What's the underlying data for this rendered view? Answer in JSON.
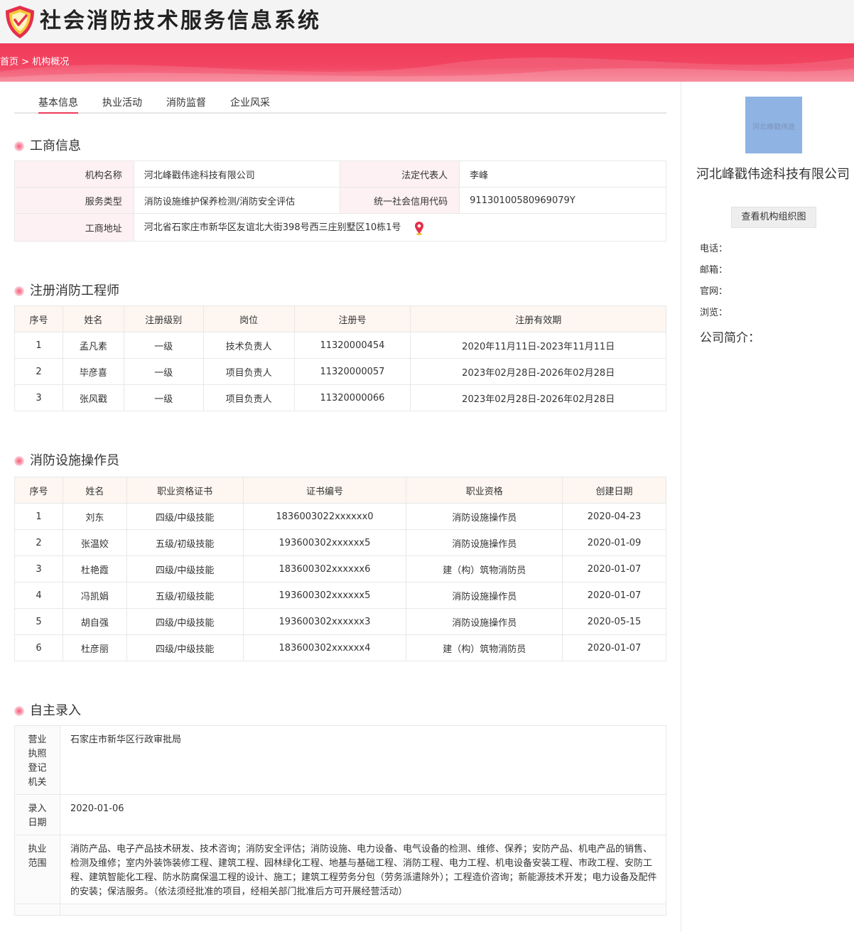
{
  "header": {
    "title": "社会消防技术服务信息系统"
  },
  "breadcrumb": {
    "home": "首页",
    "sep": ">",
    "current": "机构概况"
  },
  "tabs": [
    "基本信息",
    "执业活动",
    "消防监督",
    "企业风采"
  ],
  "business": {
    "title": "工商信息",
    "name_label": "机构名称",
    "name": "河北峰戳伟途科技有限公司",
    "legal_label": "法定代表人",
    "legal": "李峰",
    "type_label": "服务类型",
    "type": "消防设施维护保养检测/消防安全评估",
    "credit_label": "统一社会信用代码",
    "credit": "91130100580969079Y",
    "addr_label": "工商地址",
    "addr": "河北省石家庄市新华区友谊北大街398号西三庄别墅区10栋1号"
  },
  "engineers": {
    "title": "注册消防工程师",
    "headers": [
      "序号",
      "姓名",
      "注册级别",
      "岗位",
      "注册号",
      "注册有效期"
    ],
    "rows": [
      [
        "1",
        "孟凡素",
        "一级",
        "技术负责人",
        "11320000454",
        "2020年11月11日-2023年11月11日"
      ],
      [
        "2",
        "毕彦喜",
        "一级",
        "项目负责人",
        "11320000057",
        "2023年02月28日-2026年02月28日"
      ],
      [
        "3",
        "张风戳",
        "一级",
        "项目负责人",
        "11320000066",
        "2023年02月28日-2026年02月28日"
      ]
    ]
  },
  "operators": {
    "title": "消防设施操作员",
    "headers": [
      "序号",
      "姓名",
      "职业资格证书",
      "证书编号",
      "职业资格",
      "创建日期"
    ],
    "rows": [
      [
        "1",
        "刘东",
        "四级/中级技能",
        "1836003022xxxxxx0",
        "消防设施操作员",
        "2020-04-23"
      ],
      [
        "2",
        "张温姣",
        "五级/初级技能",
        "193600302xxxxxx5",
        "消防设施操作员",
        "2020-01-09"
      ],
      [
        "3",
        "杜艳霞",
        "四级/中级技能",
        "183600302xxxxxx6",
        "建（构）筑物消防员",
        "2020-01-07"
      ],
      [
        "4",
        "冯凯娟",
        "五级/初级技能",
        "193600302xxxxxx5",
        "消防设施操作员",
        "2020-01-07"
      ],
      [
        "5",
        "胡自强",
        "四级/中级技能",
        "193600302xxxxxx3",
        "消防设施操作员",
        "2020-05-15"
      ],
      [
        "6",
        "杜彦丽",
        "四级/中级技能",
        "183600302xxxxxx4",
        "建（构）筑物消防员",
        "2020-01-07"
      ]
    ]
  },
  "self_entry": {
    "title": "自主录入",
    "reg_org_label": "营业执照登记机关",
    "reg_org": "石家庄市新华区行政审批局",
    "date_label": "录入日期",
    "date": "2020-01-06",
    "scope_label": "执业范围",
    "scope": "消防产品、电子产品技术研发、技术咨询；消防安全评估；消防设施、电力设备、电气设备的检测、维修、保养；安防产品、机电产品的销售、检测及维修；室内外装饰装修工程、建筑工程、园林绿化工程、地基与基础工程、消防工程、电力工程、机电设备安装工程、市政工程、安防工程、建筑智能化工程、防水防腐保温工程的设计、施工；建筑工程劳务分包（劳务派遣除外）；工程造价咨询；新能源技术开发；电力设备及配件的安装；保洁服务。（依法须经批准的项目，经相关部门批准后方可开展经营活动）"
  },
  "sidebar": {
    "logo_text": "河北峰戳伟途",
    "company": "河北峰戳伟途科技有限公司",
    "org_button": "查看机构组织图",
    "phone_label": "电话：",
    "email_label": "邮箱：",
    "website_label": "官网：",
    "views_label": "浏览：",
    "intro_label": "公司简介："
  },
  "colors": {
    "accent": "#ee3a57",
    "label_bg": "#fdf1f3",
    "header_bg": "#fdf6f1"
  }
}
